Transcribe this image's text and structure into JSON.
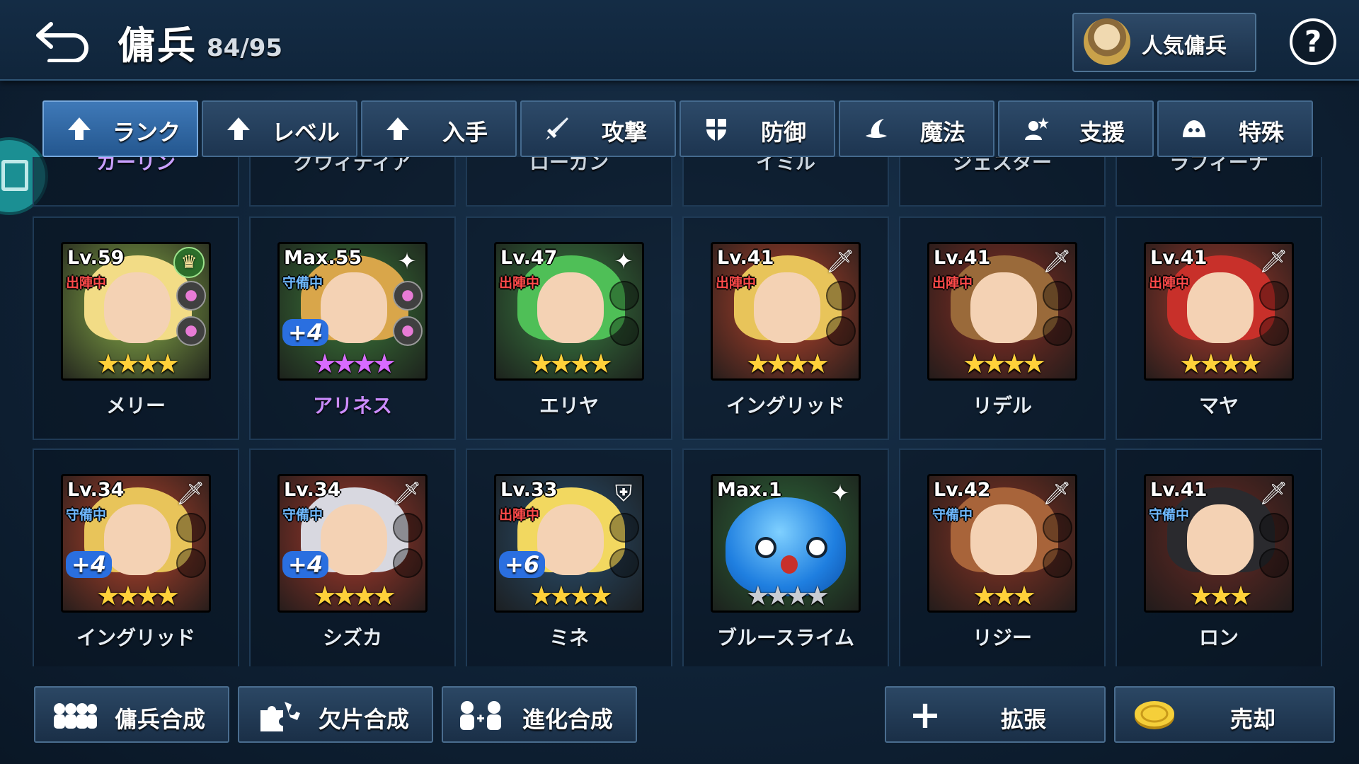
{
  "header": {
    "title": "傭兵",
    "count": "84/95",
    "popular_label": "人気傭兵"
  },
  "tabs": [
    {
      "label": "ランク",
      "icon": "arrow-up-icon"
    },
    {
      "label": "レベル",
      "icon": "arrow-up-icon"
    },
    {
      "label": "入手",
      "icon": "arrow-up-icon"
    },
    {
      "label": "攻撃",
      "icon": "sword-icon"
    },
    {
      "label": "防御",
      "icon": "shield-icon"
    },
    {
      "label": "魔法",
      "icon": "magic-hat-icon"
    },
    {
      "label": "支援",
      "icon": "support-icon"
    },
    {
      "label": "特殊",
      "icon": "slime-icon"
    }
  ],
  "partial_row": [
    "カーリン",
    "グウィディア",
    "ローガン",
    "イミル",
    "ジェスター",
    "ラフィーナ"
  ],
  "mercenaries": [
    {
      "name": "メリー",
      "level": "Lv.59",
      "status": "出陣中",
      "status_type": "atk",
      "plus": "",
      "role": "crown",
      "stars": 4,
      "star_color": "gold",
      "bg": "#8bb04a",
      "hair": "#f2dc86",
      "gems": [
        true,
        true
      ]
    },
    {
      "name": "アリネス",
      "level": "Max.55",
      "status": "守備中",
      "status_type": "def",
      "plus": "+4",
      "role": "support",
      "stars": 4,
      "star_color": "purple",
      "bg": "#3c7a3a",
      "hair": "#d9a64a",
      "gems": [
        true,
        true
      ]
    },
    {
      "name": "エリヤ",
      "level": "Lv.47",
      "status": "出陣中",
      "status_type": "atk",
      "plus": "",
      "role": "support",
      "stars": 4,
      "star_color": "gold",
      "bg": "#3a7f42",
      "hair": "#4fbf57",
      "gems": [
        false,
        false
      ]
    },
    {
      "name": "イングリッド",
      "level": "Lv.41",
      "status": "出陣中",
      "status_type": "atk",
      "plus": "",
      "role": "sword",
      "stars": 4,
      "star_color": "gold",
      "bg": "#b8442c",
      "hair": "#e8c45a",
      "gems": [
        false,
        false
      ]
    },
    {
      "name": "リデル",
      "level": "Lv.41",
      "status": "出陣中",
      "status_type": "atk",
      "plus": "",
      "role": "sword",
      "stars": 4,
      "star_color": "gold",
      "bg": "#8a2f24",
      "hair": "#9a6a3a",
      "gems": [
        false,
        false
      ]
    },
    {
      "name": "マヤ",
      "level": "Lv.41",
      "status": "出陣中",
      "status_type": "atk",
      "plus": "",
      "role": "sword",
      "stars": 4,
      "star_color": "gold",
      "bg": "#a83a2c",
      "hair": "#c8302a",
      "gems": [
        false,
        false
      ]
    },
    {
      "name": "イングリッド",
      "level": "Lv.34",
      "status": "守備中",
      "status_type": "def",
      "plus": "+4",
      "role": "sword",
      "stars": 4,
      "star_color": "gold",
      "bg": "#b8442c",
      "hair": "#e8c45a",
      "gems": [
        false,
        false
      ]
    },
    {
      "name": "シズカ",
      "level": "Lv.34",
      "status": "守備中",
      "status_type": "def",
      "plus": "+4",
      "role": "sword",
      "stars": 4,
      "star_color": "gold",
      "bg": "#a83a2c",
      "hair": "#d8d8e0",
      "gems": [
        false,
        false
      ]
    },
    {
      "name": "ミネ",
      "level": "Lv.33",
      "status": "出陣中",
      "status_type": "atk",
      "plus": "+6",
      "role": "shield",
      "stars": 4,
      "star_color": "gold",
      "bg": "#2a5070",
      "hair": "#f2d860",
      "gems": [
        false,
        false
      ]
    },
    {
      "name": "ブルースライム",
      "level": "Max.1",
      "status": "",
      "status_type": "",
      "plus": "",
      "role": "support",
      "stars": 4,
      "star_color": "silver",
      "bg": "#2f6a3a",
      "hair": "#2a7fe0",
      "gems": []
    },
    {
      "name": "リジー",
      "level": "Lv.42",
      "status": "守備中",
      "status_type": "def",
      "plus": "",
      "role": "sword",
      "stars": 3,
      "star_color": "gold",
      "bg": "#8a3424",
      "hair": "#a8643a",
      "gems": [
        false,
        false
      ]
    },
    {
      "name": "ロン",
      "level": "Lv.41",
      "status": "守備中",
      "status_type": "def",
      "plus": "",
      "role": "sword",
      "stars": 3,
      "star_color": "gold",
      "bg": "#6a2a24",
      "hair": "#2a2a2e",
      "gems": [
        false,
        false
      ]
    }
  ],
  "bottom": {
    "merge_label": "傭兵合成",
    "shard_label": "欠片合成",
    "evolve_label": "進化合成",
    "expand_label": "拡張",
    "sell_label": "売却"
  }
}
